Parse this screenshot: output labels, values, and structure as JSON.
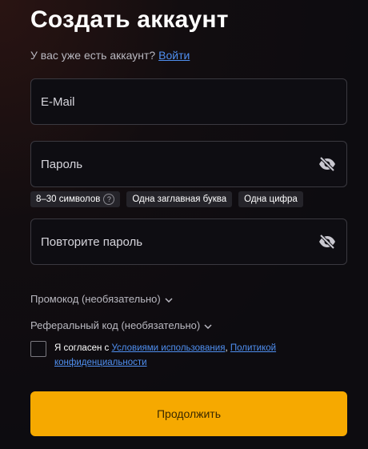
{
  "title": "Создать аккаунт",
  "login": {
    "prompt": "У вас уже есть аккаунт?",
    "link": "Войти"
  },
  "email": {
    "placeholder": "E-Mail"
  },
  "password": {
    "placeholder": "Пароль",
    "icon": "eye-off-icon"
  },
  "password_hints": [
    "8–30 символов",
    "Одна заглавная буква",
    "Одна цифра"
  ],
  "hint_help": "?",
  "confirm": {
    "placeholder": "Повторите пароль",
    "icon": "eye-off-icon"
  },
  "promo": {
    "label": "Промокод (необязательно)"
  },
  "referral": {
    "label": "Реферальный код (необязательно)"
  },
  "agree": {
    "prefix": "Я согласен с",
    "terms_link": "Условиями использования",
    "separator": ",",
    "privacy_link": "Политикой конфиденциальности",
    "checked": false
  },
  "continue_label": "Продолжить",
  "colors": {
    "accent": "#f6a900",
    "link": "#4f8ff0",
    "field_border": "#3a3940"
  }
}
